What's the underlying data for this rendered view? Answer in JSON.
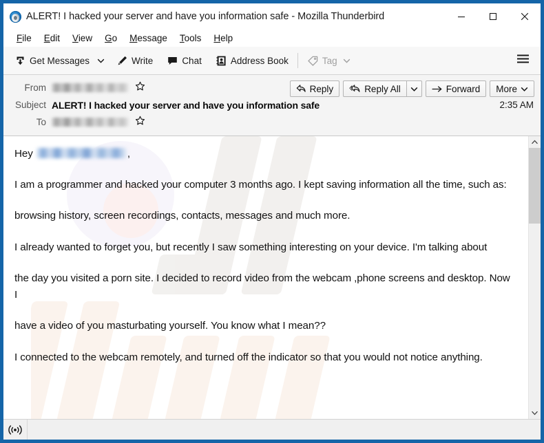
{
  "window": {
    "title": "ALERT! I hacked your server and have you information safe - Mozilla Thunderbird",
    "logo_icon": "thunderbird-logo-icon",
    "border_color": "#1565a8",
    "controls": {
      "minimize": "minimize-icon",
      "maximize": "maximize-icon",
      "close": "close-icon"
    }
  },
  "menubar": {
    "items": [
      {
        "label": "File",
        "accesskey": "F",
        "rest": "ile"
      },
      {
        "label": "Edit",
        "accesskey": "E",
        "rest": "dit"
      },
      {
        "label": "View",
        "accesskey": "V",
        "rest": "iew"
      },
      {
        "label": "Go",
        "accesskey": "G",
        "rest": "o"
      },
      {
        "label": "Message",
        "accesskey": "M",
        "rest": "essage"
      },
      {
        "label": "Tools",
        "accesskey": "T",
        "rest": "ools"
      },
      {
        "label": "Help",
        "accesskey": "H",
        "rest": "elp"
      }
    ]
  },
  "toolbar": {
    "get_messages_label": "Get Messages",
    "get_messages_icon": "download-inbox-icon",
    "get_messages_dropdown_icon": "chevron-down-icon",
    "write_label": "Write",
    "write_icon": "pencil-icon",
    "chat_label": "Chat",
    "chat_icon": "speech-bubble-icon",
    "address_book_label": "Address Book",
    "address_book_icon": "address-book-icon",
    "tag_label": "Tag",
    "tag_icon": "tag-icon",
    "tag_dropdown_icon": "chevron-down-icon",
    "tag_disabled": true,
    "app_menu_icon": "hamburger-menu-icon"
  },
  "message_header": {
    "from_label": "From",
    "from_value": "",
    "from_redacted": true,
    "from_star_icon": "star-outline-icon",
    "subject_label": "Subject",
    "subject_value": "ALERT! I hacked your server and have you information safe",
    "time": "2:35 AM",
    "to_label": "To",
    "to_value": "",
    "to_redacted": true,
    "to_star_icon": "star-outline-icon",
    "actions": {
      "reply_label": "Reply",
      "reply_icon": "reply-arrow-icon",
      "reply_all_label": "Reply All",
      "reply_all_icon": "reply-all-arrow-icon",
      "reply_all_dropdown_icon": "chevron-down-icon",
      "forward_label": "Forward",
      "forward_icon": "forward-arrow-icon",
      "more_label": "More",
      "more_dropdown_icon": "chevron-down-icon"
    }
  },
  "message_body": {
    "greeting_prefix": "Hey ",
    "greeting_redacted": true,
    "greeting_suffix": ",",
    "paragraphs": [
      "I am a programmer and hacked your computer 3 months ago. I kept saving information all the time, such as:",
      "browsing history, screen recordings, contacts, messages and much more.",
      "I already wanted to forget you, but recently I saw something interesting on your device. I'm talking about",
      "the day you visited a porn site. I decided to record video from the webcam ,phone screens and desktop. Now I",
      "have a video of you masturbating yourself. You know what I mean??",
      "I connected to the webcam remotely, and turned off the indicator so that you would not notice anything."
    ],
    "scrollbar": {
      "up_arrow_icon": "chevron-up-icon",
      "down_arrow_icon": "chevron-down-icon"
    }
  },
  "statusbar": {
    "connection_icon": "broadcast-signal-icon",
    "text": ""
  }
}
